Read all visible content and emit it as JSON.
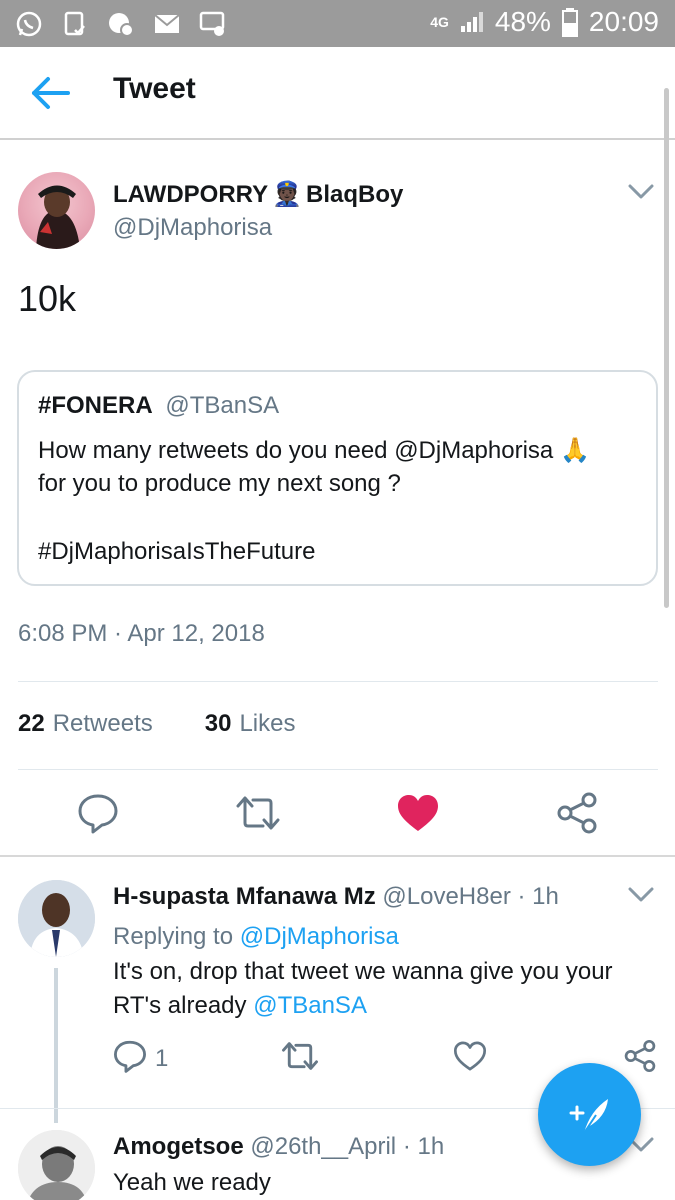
{
  "status_bar": {
    "network": "4G",
    "battery": "48%",
    "time": "20:09"
  },
  "header": {
    "title": "Tweet"
  },
  "tweet": {
    "author_name": "LAWDPORRY",
    "author_name_suffix": "BlaqBoy",
    "author_emoji": "👮🏿",
    "handle": "@DjMaphorisa",
    "text": "10k",
    "quoted": {
      "name": "#FONERA",
      "handle": "@TBanSA",
      "line1": "How many retweets do you need @DjMaphorisa 🙏",
      "line2": "for you to produce my next song ?",
      "line3": "#DjMaphorisaIsTheFuture"
    },
    "timestamp": "6:08 PM · Apr 12, 2018",
    "retweets_count": "22",
    "retweets_label": "Retweets",
    "likes_count": "30",
    "likes_label": "Likes",
    "liked": true,
    "colors": {
      "like_active": "#e0245e",
      "link": "#1da1f2",
      "muted": "#657786"
    }
  },
  "replies": [
    {
      "name": "H-supasta Mfanawa Mz",
      "handle": "@LoveH8er",
      "time": "· 1h",
      "replying_label": "Replying to",
      "replying_to": "@DjMaphorisa",
      "line1": "It's on, drop that tweet we wanna give you your",
      "line2_text": "RT's already",
      "line2_link": "@TBanSA",
      "reply_count": "1"
    },
    {
      "name": "Amogetsoe",
      "handle": "@26th__April",
      "time": "· 1h",
      "text": "Yeah we ready"
    }
  ],
  "icons": {
    "back": "back-arrow-icon",
    "caret": "chevron-down-icon",
    "reply": "reply-icon",
    "retweet": "retweet-icon",
    "like": "heart-icon",
    "share": "share-icon",
    "compose": "compose-icon"
  }
}
